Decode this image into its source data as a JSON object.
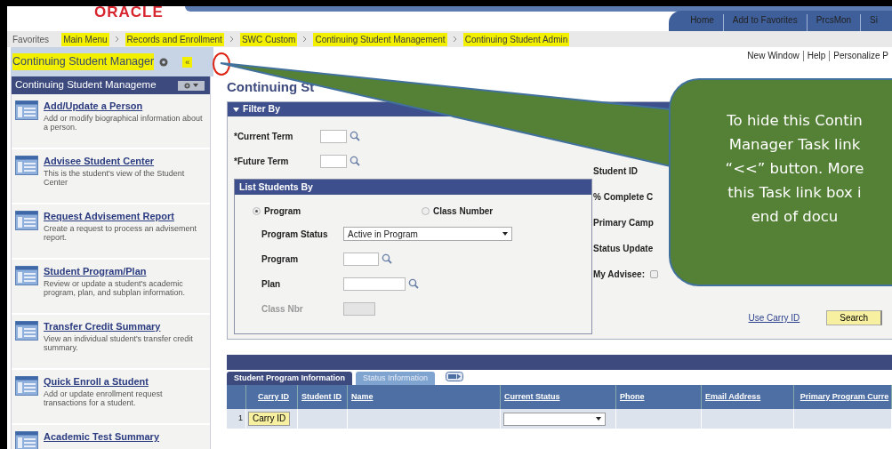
{
  "logo": "ORACLE",
  "header_links": [
    {
      "label": "Home"
    },
    {
      "label": "Add to Favorites"
    },
    {
      "label": "PrcsMon"
    },
    {
      "label": "Si"
    }
  ],
  "breadcrumb": [
    {
      "label": "Favorites",
      "highlighted": false
    },
    {
      "label": "Main Menu",
      "highlighted": true
    },
    {
      "label": "Records and Enrollment",
      "highlighted": true
    },
    {
      "label": "SWC Custom",
      "highlighted": true
    },
    {
      "label": "Continuing Student Management",
      "highlighted": true
    },
    {
      "label": "Continuing Student Admin",
      "highlighted": true
    }
  ],
  "task_panel": {
    "title": "Continuing Student Manager",
    "highlighted": true,
    "collapse_button": "«"
  },
  "page_links": [
    "New Window",
    "Help",
    "Personalize P"
  ],
  "sidebar": {
    "title": "Continuing Student Manageme",
    "items": [
      {
        "title": "Add/Update a Person",
        "description": "Add or modify biographical information about a person."
      },
      {
        "title": "Advisee Student Center",
        "description": "This is the student's view of the Student Center"
      },
      {
        "title": "Request Advisement Report",
        "description": "Create a request to process an advisement report."
      },
      {
        "title": "Student Program/Plan",
        "description": "Review or update a student's academic program, plan, and subplan information."
      },
      {
        "title": "Transfer Credit Summary",
        "description": "View an individual student's transfer credit summary."
      },
      {
        "title": "Quick Enroll a Student",
        "description": "Add or update enrollment request transactions for a student."
      },
      {
        "title": "Academic Test Summary"
      }
    ]
  },
  "page_title": "Continuing St",
  "filter": {
    "title": "Filter By",
    "expanded": true,
    "term_fields": [
      {
        "label": "*Current Term"
      },
      {
        "label": "*Future Term"
      }
    ],
    "right_fields": [
      {
        "label": "Student ID",
        "kind": "label"
      },
      {
        "label": "% Complete C",
        "kind": "label"
      },
      {
        "label": "Primary Camp",
        "kind": "label"
      },
      {
        "label": "Status Update",
        "kind": "label"
      },
      {
        "label": "My Advisee:",
        "kind": "checkbox",
        "checked": false
      }
    ],
    "list_by": {
      "title": "List Students By",
      "options": [
        {
          "label": "Program",
          "selected": true
        },
        {
          "label": "Class Number",
          "selected": false
        }
      ],
      "fields": [
        {
          "label": "Program Status",
          "kind": "select",
          "value": "Active in Program",
          "disabled": false
        },
        {
          "label": "Program",
          "kind": "lookup",
          "disabled": false
        },
        {
          "label": "Plan",
          "kind": "lookup_wide",
          "disabled": false
        },
        {
          "label": "Class Nbr",
          "kind": "text",
          "disabled": true
        }
      ]
    },
    "carry_link": "Use Carry ID",
    "search_button": "Search"
  },
  "grid": {
    "tabs": [
      {
        "label": "Student Program Information",
        "selected": true
      },
      {
        "label": "Status Information",
        "selected": false
      }
    ],
    "columns": [
      "Carry ID",
      "Student ID",
      "Name",
      "Current Status",
      "Phone",
      "Email Address",
      "Primary Program Curre"
    ],
    "rows": [
      {
        "number": "1",
        "carry_button": "Carry ID"
      }
    ]
  },
  "callout": {
    "lines": [
      "To hide this Contin",
      "Manager Task link",
      "“<<” button. More",
      "this Task link box i",
      "end of docu"
    ]
  }
}
